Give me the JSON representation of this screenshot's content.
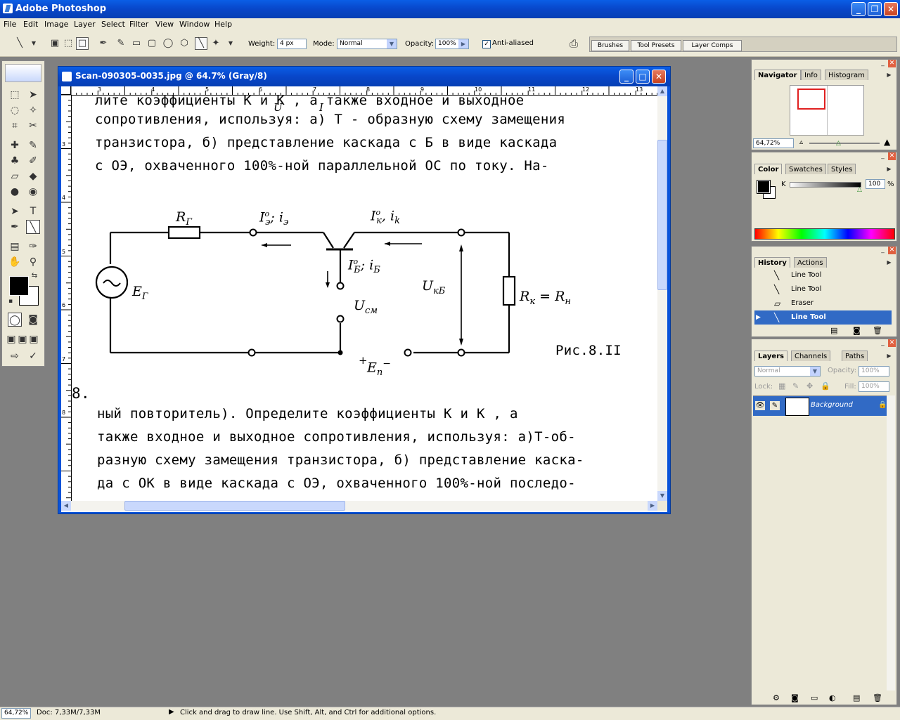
{
  "app": {
    "title": "Adobe Photoshop"
  },
  "menu": [
    "File",
    "Edit",
    "Image",
    "Layer",
    "Select",
    "Filter",
    "View",
    "Window",
    "Help"
  ],
  "options": {
    "weight_label": "Weight:",
    "weight_value": "4 px",
    "mode_label": "Mode:",
    "mode_value": "Normal",
    "opacity_label": "Opacity:",
    "opacity_value": "100%",
    "antialias_label": "Anti-aliased",
    "antialias_checked": true
  },
  "palette_well": {
    "tabs": [
      "Brushes",
      "Tool Presets",
      "Layer Comps"
    ]
  },
  "document": {
    "title": "Scan-090305-0035.jpg @ 64.7% (Gray/8)",
    "ruler_h": [
      "3",
      "4",
      "5",
      "6",
      "7",
      "8",
      "9",
      "10",
      "11",
      "12",
      "13"
    ],
    "ruler_v": [
      "3",
      "4",
      "5",
      "6",
      "7",
      "8"
    ],
    "text_top": [
      "лите коэффициенты K  и K  , а также входное и выходное",
      "сопротивления, используя: а) Т - образную схему замещения",
      "транзистора, б) представление каскада с Б в виде каскада",
      "с ОЭ, охваченного 100%-ной параллельной ОС по току.  На-"
    ],
    "sub_u": "U",
    "sub_i": "I",
    "circuit": {
      "rg": "R",
      "rg_sub": "Г",
      "ie": "I",
      "ie_sup": "o",
      "ie_sub": "э",
      "ie_rest": "; i",
      "ie_rest_sub": "э",
      "ik": "I",
      "ik_sup": "o",
      "ik_sub": "к",
      "ik_rest": ", i",
      "ik_rest_sub": "k",
      "ib": "I",
      "ib_sup": "o",
      "ib_sub": "Б",
      "ib_rest": "; i",
      "ib_rest_sub": "Б",
      "ucm": "U",
      "ucm_sub": "см",
      "ukb": "U",
      "ukb_sub": "кБ",
      "eg": "E",
      "eg_sub": "Г",
      "rk": "R",
      "rk_sub": "к",
      "rk_eq": " = R",
      "rk_eq_sub": "н",
      "ep_plus": "+",
      "ep": "E",
      "ep_sub": "п",
      "ep_minus": "−",
      "fig": "Рис.8.II"
    },
    "problem_num": "8.",
    "text_bottom": [
      "ный повторитель). Определите коэффициенты K  и K  , а",
      "также входное и выходное сопротивления, используя: а)Т-об-",
      "разную схему замещения транзистора, б) представление каска-",
      "да с ОК в виде каскада с ОЭ, охваченного 100%-ной последо-"
    ]
  },
  "navigator": {
    "tabs": [
      "Navigator",
      "Info",
      "Histogram"
    ],
    "zoom": "64,72%"
  },
  "color": {
    "tabs": [
      "Color",
      "Swatches",
      "Styles"
    ],
    "channel": "K",
    "value": "100",
    "pct": "%"
  },
  "history": {
    "tabs": [
      "History",
      "Actions"
    ],
    "items": [
      "Line Tool",
      "Line Tool",
      "Eraser",
      "Line Tool"
    ]
  },
  "layers": {
    "tabs": [
      "Layers",
      "Channels",
      "Paths"
    ],
    "blend": "Normal",
    "opacity_label": "Opacity:",
    "opacity": "100%",
    "lock_label": "Lock:",
    "fill_label": "Fill:",
    "fill": "100%",
    "layer_name": "Background"
  },
  "status": {
    "zoom": "64,72%",
    "doc": "Doc: 7,33M/7,33M",
    "hint": "Click and drag to draw line.  Use Shift, Alt, and Ctrl for additional options."
  }
}
